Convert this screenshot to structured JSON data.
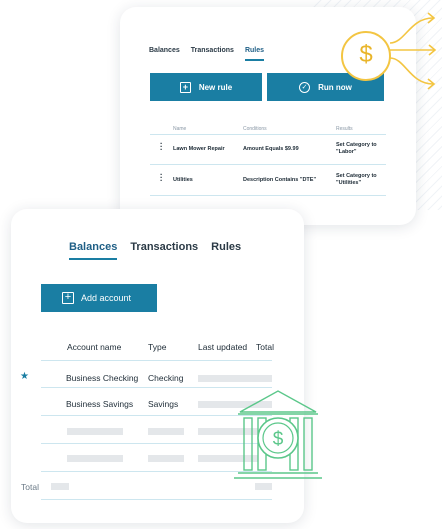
{
  "rules_card": {
    "tabs": [
      {
        "label": "Balances",
        "active": false
      },
      {
        "label": "Transactions",
        "active": false
      },
      {
        "label": "Rules",
        "active": true
      }
    ],
    "new_rule_label": "New rule",
    "run_now_label": "Run now",
    "columns": [
      "Name",
      "Conditions",
      "Results"
    ],
    "rows": [
      {
        "name": "Lawn Mower Repair",
        "condition": "Amount Equals $9.99",
        "result": "Set Category to \"Labor\""
      },
      {
        "name": "Utilities",
        "condition": "Description Contains \"DTE\"",
        "result": "Set Category to \"Utilities\""
      }
    ]
  },
  "coin": {
    "symbol": "$"
  },
  "balances_card": {
    "tabs": [
      {
        "label": "Balances",
        "active": true
      },
      {
        "label": "Transactions",
        "active": false
      },
      {
        "label": "Rules",
        "active": false
      }
    ],
    "add_account_label": "Add account",
    "columns": [
      "Account name",
      "Type",
      "Last updated",
      "Total"
    ],
    "rows": [
      {
        "name": "Business Checking",
        "type": "Checking",
        "starred": true
      },
      {
        "name": "Business Savings",
        "type": "Savings",
        "starred": false
      }
    ],
    "total_label": "Total"
  },
  "bank_icon": {
    "symbol": "$"
  },
  "colors": {
    "primary": "#1a7ea3",
    "accent_gold": "#f3c542",
    "accent_green": "#5bc78a",
    "divider": "#cde6ef"
  }
}
